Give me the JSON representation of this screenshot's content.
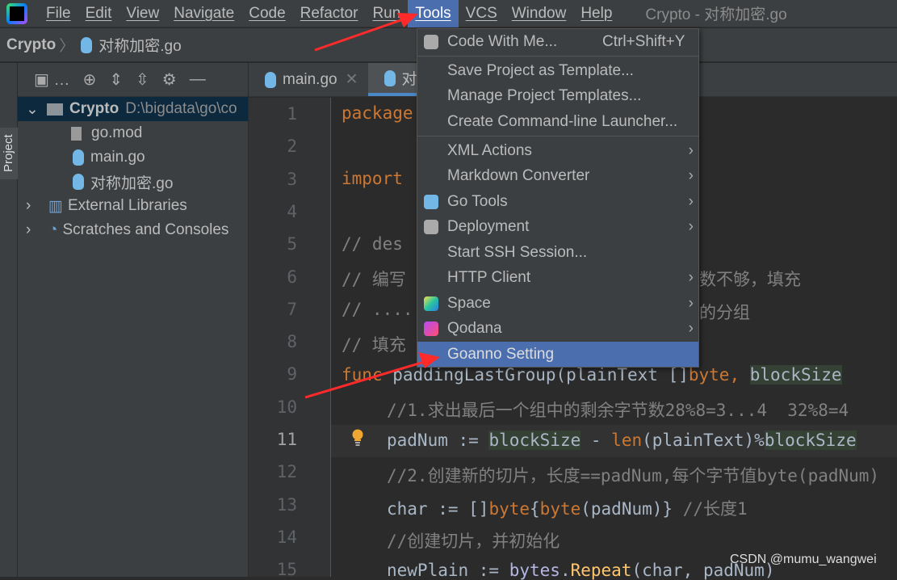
{
  "menubar": {
    "items": [
      "File",
      "Edit",
      "View",
      "Navigate",
      "Code",
      "Refactor",
      "Run",
      "Tools",
      "VCS",
      "Window",
      "Help"
    ],
    "active": "Tools",
    "window_title": "Crypto - 对称加密.go"
  },
  "breadcrumb": {
    "project": "Crypto",
    "file": "对称加密.go"
  },
  "sidebar": {
    "tool_window": "Project"
  },
  "project_tree": [
    {
      "label": "Crypto",
      "path": "D:\\bigdata\\go\\co",
      "level": 0,
      "expanded": true,
      "selected": true
    },
    {
      "label": "go.mod",
      "level": 2
    },
    {
      "label": "main.go",
      "level": 2
    },
    {
      "label": "对称加密.go",
      "level": 2
    },
    {
      "label": "External Libraries",
      "level": 0
    },
    {
      "label": "Scratches and Consoles",
      "level": 0
    }
  ],
  "tabs": [
    {
      "label": "main.go",
      "active": false
    },
    {
      "label": "对",
      "active": true
    }
  ],
  "editor": {
    "line_numbers": [
      "1",
      "2",
      "3",
      "4",
      "5",
      "6",
      "7",
      "8",
      "9",
      "10",
      "11",
      "12",
      "13",
      "14",
      "15"
    ],
    "current_line": "11",
    "visible_fragments": {
      "l1": "package",
      "l3": "import",
      "l5": "// des",
      "l6": "// 编写",
      "l6r": "数不够，填充",
      "l7": "// ....",
      "l7r": "的分组",
      "l8": "// 填充"
    },
    "l9": {
      "a": "func",
      "b": " paddingLastGroup(plainText []",
      "c": "byte",
      "d": ", ",
      "e": "blockSize"
    },
    "l10": "//1.求出最后一个组中的剩余字节数28%8=3...4  32%8=4",
    "l11": {
      "a": "padNum := ",
      "b": "blockSize",
      "c": " - ",
      "d": "len",
      "e": "(plainText)%",
      "f": "blockSize"
    },
    "l12": "//2.创建新的切片，长度==padNum,每个字节值byte(padNum)",
    "l13": {
      "a": "char := []",
      "b": "byte",
      "c": "{",
      "d": "byte",
      "e": "(padNum)} ",
      "f": "//长度1"
    },
    "l14": "//创建切片，并初始化",
    "l15": {
      "a": "newPlain := ",
      "b": "bytes",
      "c": ".",
      "d": "Repeat",
      "e": "(char, padNum)"
    }
  },
  "tools_menu": {
    "items": [
      {
        "label": "Code With Me...",
        "shortcut": "Ctrl+Shift+Y",
        "icon": "user-icon"
      },
      {
        "label": "Save Project as Template..."
      },
      {
        "label": "Manage Project Templates..."
      },
      {
        "label": "Create Command-line Launcher..."
      },
      {
        "label": "XML Actions",
        "submenu": true
      },
      {
        "label": "Markdown Converter",
        "submenu": true
      },
      {
        "label": "Go Tools",
        "submenu": true,
        "icon": "gopher-icon"
      },
      {
        "label": "Deployment",
        "submenu": true,
        "icon": "deployment-icon"
      },
      {
        "label": "Start SSH Session..."
      },
      {
        "label": "HTTP Client",
        "submenu": true
      },
      {
        "label": "Space",
        "submenu": true,
        "icon": "space-icon"
      },
      {
        "label": "Qodana",
        "submenu": true,
        "icon": "qodana-icon"
      },
      {
        "label": "Goanno Setting",
        "highlighted": true
      }
    ]
  },
  "watermark": "CSDN @mumu_wangwei",
  "colors": {
    "accent": "#4b6eaf",
    "annotation_arrow": "#ff2a2a"
  }
}
